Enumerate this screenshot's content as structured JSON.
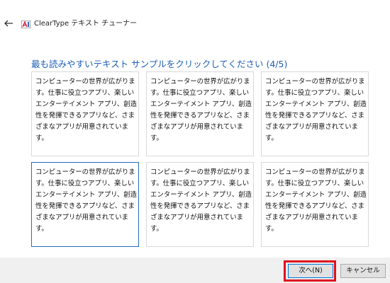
{
  "window": {
    "title": "ClearType テキスト チューナー",
    "back_icon": "back-arrow-icon",
    "app_icon": "cleartype-app-icon"
  },
  "main": {
    "heading": "最も読みやすいテキスト サンプルをクリックしてください (4/5)",
    "samples": [
      {
        "text": "コンピューターの世界が広がります。仕事に役立つアプリ、楽しいエンターテイメント アプリ、創造性を発揮できるアプリなど、さまざまなアプリが用意されています。",
        "selected": false
      },
      {
        "text": "コンピューターの世界が広がります。仕事に役立つアプリ、楽しいエンターテイメント アプリ、創造性を発揮できるアプリなど、さまざまなアプリが用意されています。",
        "selected": false
      },
      {
        "text": "コンピューターの世界が広がります。仕事に役立つアプリ、楽しいエンターテイメント アプリ、創造性を発揮できるアプリなど、さまざまなアプリが用意されています。",
        "selected": false
      },
      {
        "text": "コンピューターの世界が広がります。仕事に役立つアプリ、楽しいエンターテイメント アプリ、創造性を発揮できるアプリなど、さまざまなアプリが用意されています。",
        "selected": true
      },
      {
        "text": "コンピューターの世界が広がります。仕事に役立つアプリ、楽しいエンターテイメント アプリ、創造性を発揮できるアプリなど、さまざまなアプリが用意されています。",
        "selected": false
      },
      {
        "text": "コンピューターの世界が広がります。仕事に役立つアプリ、楽しいエンターテイメント アプリ、創造性を発揮できるアプリなど、さまざまなアプリが用意されています。",
        "selected": false
      }
    ]
  },
  "footer": {
    "next_label": "次へ(N)",
    "cancel_label": "キャンセル"
  },
  "colors": {
    "heading": "#1f5fb5",
    "selected_border": "#2a6bbf",
    "highlight": "#e0101d"
  }
}
